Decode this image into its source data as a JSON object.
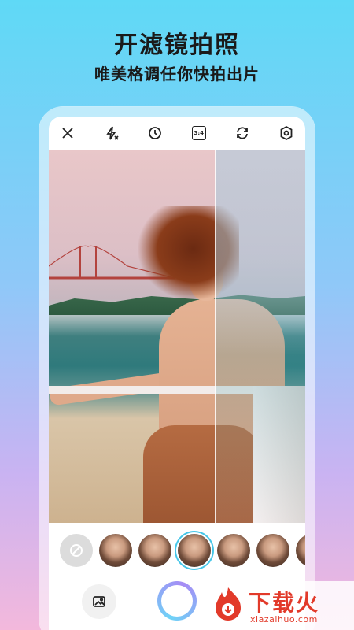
{
  "hero": {
    "title": "开滤镜拍照",
    "subtitle": "唯美格调任你快拍出片"
  },
  "toolbar": {
    "icons": [
      "close-icon",
      "flash-auto-icon",
      "timer-icon",
      "ratio-icon",
      "switch-camera-icon",
      "settings-icon"
    ],
    "ratio_label": "3:4"
  },
  "filter_strip": {
    "selected_index": 3,
    "count": 7
  },
  "watermark": {
    "title": "下载火",
    "domain": "xiazaihuo.com"
  },
  "colors": {
    "accent": "#46c6e8",
    "shutter_gradient_start": "#6fd3f7",
    "shutter_gradient_end": "#a78bf5",
    "watermark_red": "#e23a2a"
  }
}
